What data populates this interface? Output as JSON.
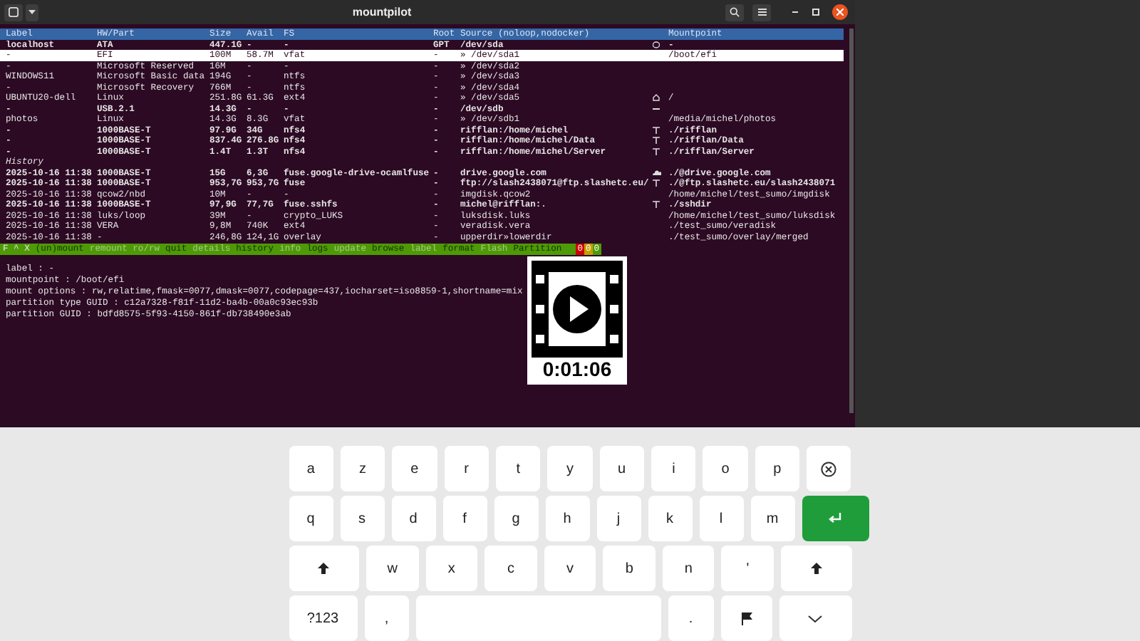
{
  "window": {
    "title": "mountpilot"
  },
  "table": {
    "columns": [
      "Label",
      "HW/Part",
      "Size",
      "Avail",
      "FS",
      "Root",
      "Source (noloop,nodocker)",
      "",
      "Mountpoint"
    ],
    "rows": [
      {
        "cells": [
          "localhost",
          "ATA",
          "447.1G",
          "-",
          "-",
          "GPT",
          "/dev/sda",
          "",
          "-"
        ],
        "kind": "disk",
        "bold": true,
        "selected": false
      },
      {
        "cells": [
          "-",
          "EFI",
          "100M",
          "58.7M",
          "vfat",
          "-",
          "» /dev/sda1",
          "",
          "/boot/efi"
        ],
        "bold": false,
        "selected": true
      },
      {
        "cells": [
          "-",
          "Microsoft Reserved",
          "16M",
          "-",
          "-",
          "-",
          "» /dev/sda2",
          "",
          ""
        ],
        "bold": false,
        "selected": false
      },
      {
        "cells": [
          "WINDOWS11",
          "Microsoft Basic data",
          "194G",
          "-",
          "ntfs",
          "-",
          "» /dev/sda3",
          "",
          ""
        ],
        "bold": false,
        "selected": false
      },
      {
        "cells": [
          "-",
          "Microsoft Recovery",
          "766M",
          "-",
          "ntfs",
          "-",
          "» /dev/sda4",
          "",
          ""
        ],
        "bold": false,
        "selected": false
      },
      {
        "cells": [
          "UBUNTU20-dell",
          "Linux",
          "251.8G",
          "61.3G",
          "ext4",
          "-",
          "» /dev/sda5",
          "",
          "/"
        ],
        "kind": "home",
        "bold": false,
        "selected": false
      },
      {
        "cells": [
          "-",
          "USB.2.1",
          "14.3G",
          "-",
          "-",
          "-",
          "/dev/sdb",
          "",
          ""
        ],
        "kind": "usb",
        "bold": true,
        "selected": false
      },
      {
        "cells": [
          "photos",
          "Linux",
          "14.3G",
          "8.3G",
          "vfat",
          "-",
          "» /dev/sdb1",
          "",
          "/media/michel/photos"
        ],
        "bold": false,
        "selected": false
      },
      {
        "cells": [
          "-",
          "1000BASE-T",
          "97.9G",
          "34G",
          "nfs4",
          "-",
          "rifflan:/home/michel",
          "",
          "./rifflan"
        ],
        "kind": "network",
        "bold": true,
        "selected": false
      },
      {
        "cells": [
          "-",
          "1000BASE-T",
          "837.4G",
          "276.8G",
          "nfs4",
          "-",
          "rifflan:/home/michel/Data",
          "",
          "./rifflan/Data"
        ],
        "kind": "network",
        "bold": true,
        "selected": false
      },
      {
        "cells": [
          "-",
          "1000BASE-T",
          "1.4T",
          "1.3T",
          "nfs4",
          "-",
          "rifflan:/home/michel/Server",
          "",
          "./rifflan/Server"
        ],
        "kind": "network",
        "bold": true,
        "selected": false
      }
    ]
  },
  "history": {
    "title": "History",
    "rows": [
      {
        "cells": [
          "2025-10-16 11:38",
          "1000BASE-T",
          "15G",
          "6,3G",
          "fuse.google-drive-ocamlfuse",
          "-",
          "drive.google.com",
          "",
          "./@drive.google.com"
        ],
        "kind": "cloud",
        "bold": true
      },
      {
        "cells": [
          "2025-10-16 11:38",
          "1000BASE-T",
          "953,7G",
          "953,7G",
          "fuse",
          "-",
          "ftp://slash2438071@ftp.slashetc.eu/",
          "",
          "./@ftp.slashetc.eu/slash2438071"
        ],
        "kind": "network",
        "bold": true
      },
      {
        "cells": [
          "2025-10-16 11:38",
          "qcow2/nbd",
          "10M",
          "-",
          "-",
          "-",
          "imgdisk.qcow2",
          "",
          "/home/michel/test_sumo/imgdisk"
        ],
        "bold": false
      },
      {
        "cells": [
          "2025-10-16 11:38",
          "1000BASE-T",
          "97,9G",
          "77,7G",
          "fuse.sshfs",
          "-",
          "michel@rifflan:.",
          "",
          "./sshdir"
        ],
        "kind": "network",
        "bold": true
      },
      {
        "cells": [
          "2025-10-16 11:38",
          "luks/loop",
          "39M",
          "-",
          "crypto_LUKS",
          "-",
          "luksdisk.luks",
          "",
          "/home/michel/test_sumo/luksdisk"
        ],
        "bold": false
      },
      {
        "cells": [
          "2025-10-16 11:38",
          "VERA",
          "9,8M",
          "740K",
          "ext4",
          "-",
          "veradisk.vera",
          "",
          "./test_sumo/veradisk"
        ],
        "bold": false
      },
      {
        "cells": [
          "2025-10-16 11:38",
          "-",
          "246,8G",
          "124,1G",
          "overlay",
          "-",
          "upperdir»lowerdir",
          "",
          "./test_sumo/overlay/merged"
        ],
        "bold": false
      }
    ]
  },
  "menu_bar": {
    "prefix": "F ^ X",
    "items": [
      "(un)mount",
      "remount ro/rw",
      "quit",
      "details",
      "history",
      "info",
      "logs",
      "update",
      "browse",
      "label",
      "format",
      "Flash",
      "Partition"
    ],
    "counters": [
      {
        "text": "0",
        "color": "#cc0000"
      },
      {
        "text": "0",
        "color": "#c4a000"
      },
      {
        "text": "0",
        "color": "#4e9a06"
      }
    ]
  },
  "details": [
    "label : -",
    "mountpoint : /boot/efi",
    "mount options : rw,relatime,fmask=0077,dmask=0077,codepage=437,iocharset=iso8859-1,shortname=mix",
    "partition type GUID : c12a7328-f81f-11d2-ba4b-00a0c93ec93b",
    "partition GUID : bdfd8575-5f93-4150-861f-db738490e3ab"
  ],
  "video_overlay": {
    "duration": "0:01:06"
  },
  "keyboard": {
    "rows": [
      {
        "keys": [
          {
            "kind": "char",
            "label": "a"
          },
          {
            "kind": "char",
            "label": "z"
          },
          {
            "kind": "char",
            "label": "e"
          },
          {
            "kind": "char",
            "label": "r"
          },
          {
            "kind": "char",
            "label": "t"
          },
          {
            "kind": "char",
            "label": "y"
          },
          {
            "kind": "char",
            "label": "u"
          },
          {
            "kind": "char",
            "label": "i"
          },
          {
            "kind": "char",
            "label": "o"
          },
          {
            "kind": "char",
            "label": "p"
          },
          {
            "kind": "backspace"
          }
        ]
      },
      {
        "keys": [
          {
            "kind": "char",
            "label": "q"
          },
          {
            "kind": "char",
            "label": "s"
          },
          {
            "kind": "char",
            "label": "d"
          },
          {
            "kind": "char",
            "label": "f"
          },
          {
            "kind": "char",
            "label": "g"
          },
          {
            "kind": "char",
            "label": "h"
          },
          {
            "kind": "char",
            "label": "j"
          },
          {
            "kind": "char",
            "label": "k"
          },
          {
            "kind": "char",
            "label": "l"
          },
          {
            "kind": "char",
            "label": "m"
          },
          {
            "kind": "enter"
          }
        ]
      },
      {
        "keys": [
          {
            "kind": "shift"
          },
          {
            "kind": "char",
            "label": "w"
          },
          {
            "kind": "char",
            "label": "x"
          },
          {
            "kind": "char",
            "label": "c"
          },
          {
            "kind": "char",
            "label": "v"
          },
          {
            "kind": "char",
            "label": "b"
          },
          {
            "kind": "char",
            "label": "n"
          },
          {
            "kind": "char",
            "label": "'"
          },
          {
            "kind": "shift"
          }
        ]
      },
      {
        "keys": [
          {
            "kind": "symbols",
            "label": "?123"
          },
          {
            "kind": "char",
            "label": ","
          },
          {
            "kind": "space"
          },
          {
            "kind": "char",
            "label": "."
          },
          {
            "kind": "flag"
          },
          {
            "kind": "hide"
          }
        ]
      }
    ]
  }
}
